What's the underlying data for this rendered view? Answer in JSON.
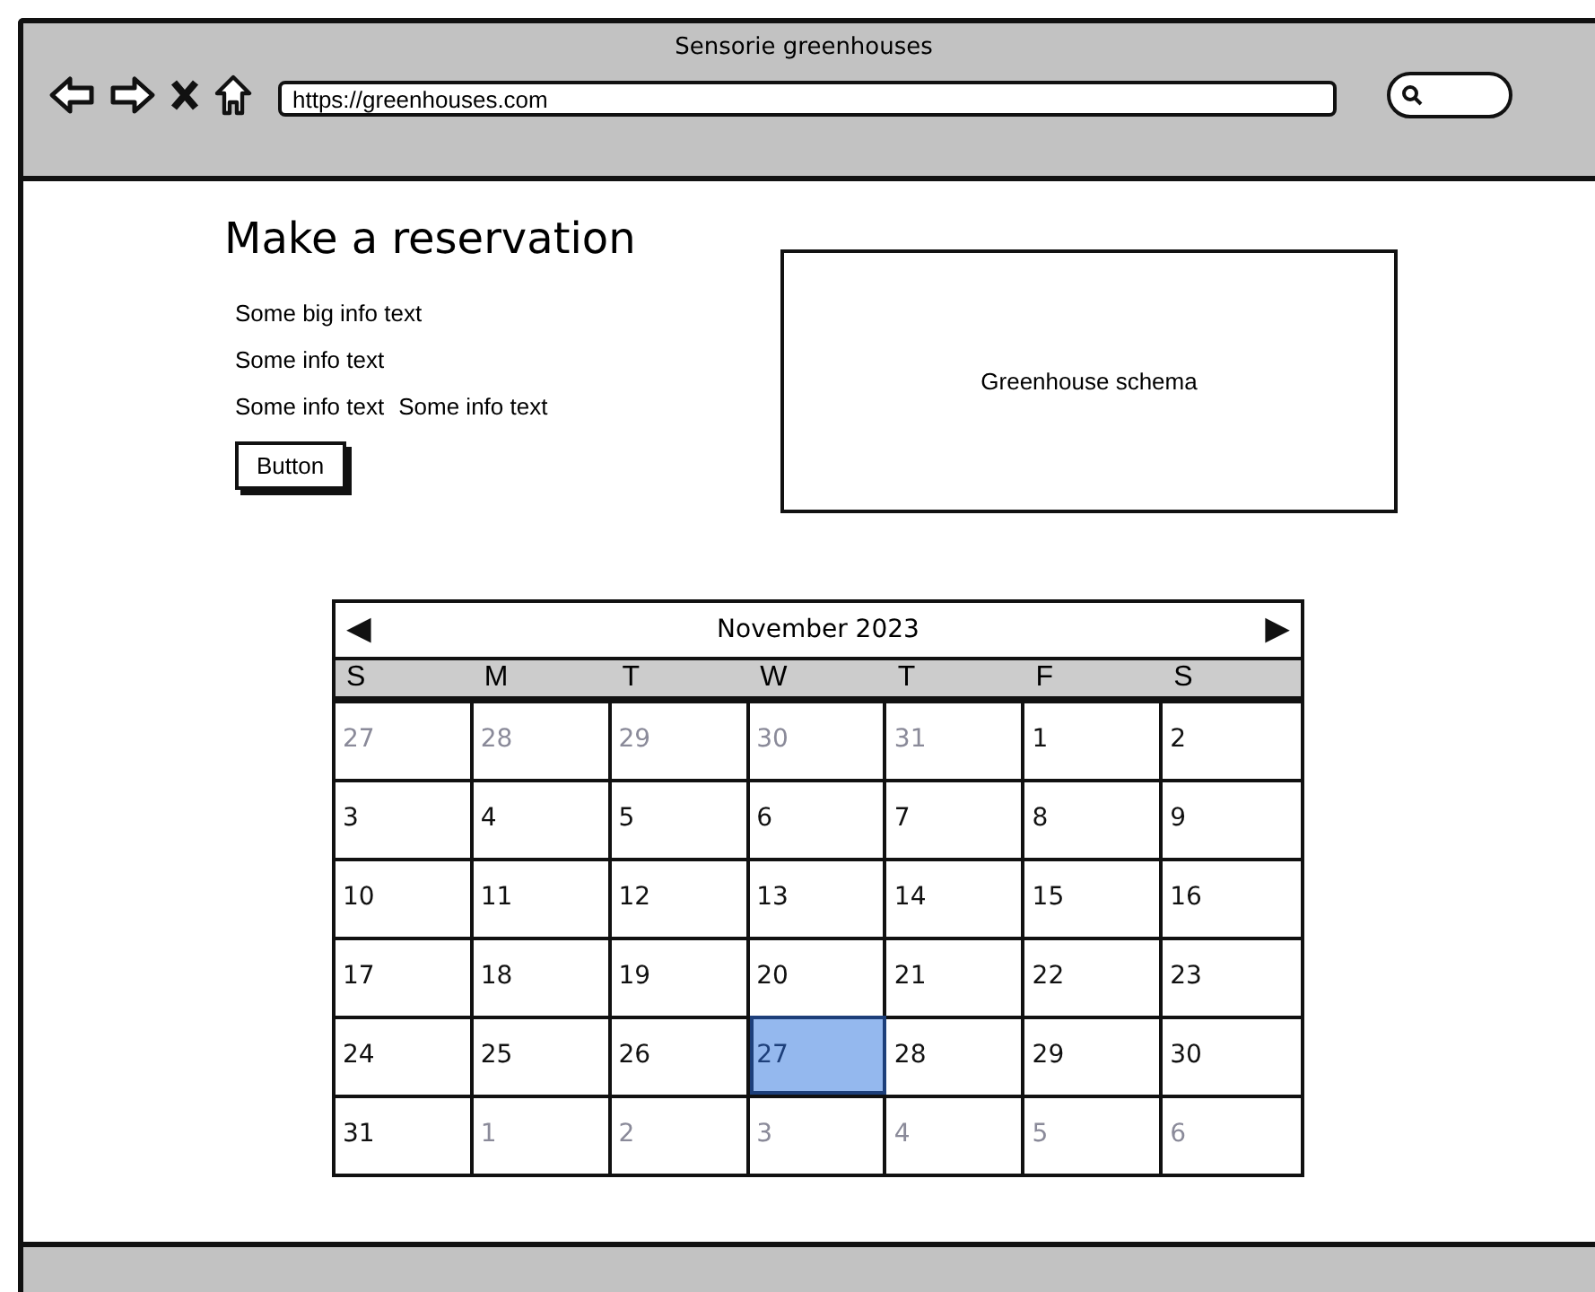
{
  "window": {
    "title": "Sensorie greenhouses"
  },
  "browser": {
    "url": "https://greenhouses.com"
  },
  "page": {
    "heading": "Make a reservation",
    "info_big": "Some big info text",
    "info_lines": [
      [
        "Some info text"
      ],
      [
        "Some info text",
        "Some info text"
      ]
    ],
    "button": "Button",
    "schema": "Greenhouse schema"
  },
  "calendar": {
    "month": "November 2023",
    "prev": "◀",
    "next": "▶",
    "weekdays": [
      "S",
      "M",
      "T",
      "W",
      "T",
      "F",
      "S"
    ],
    "weeks": [
      [
        {
          "day": "27",
          "in_month": false,
          "selected": false
        },
        {
          "day": "28",
          "in_month": false,
          "selected": false
        },
        {
          "day": "29",
          "in_month": false,
          "selected": false
        },
        {
          "day": "30",
          "in_month": false,
          "selected": false
        },
        {
          "day": "31",
          "in_month": false,
          "selected": false
        },
        {
          "day": "1",
          "in_month": true,
          "selected": false
        },
        {
          "day": "2",
          "in_month": true,
          "selected": false
        }
      ],
      [
        {
          "day": "3",
          "in_month": true,
          "selected": false
        },
        {
          "day": "4",
          "in_month": true,
          "selected": false
        },
        {
          "day": "5",
          "in_month": true,
          "selected": false
        },
        {
          "day": "6",
          "in_month": true,
          "selected": false
        },
        {
          "day": "7",
          "in_month": true,
          "selected": false
        },
        {
          "day": "8",
          "in_month": true,
          "selected": false
        },
        {
          "day": "9",
          "in_month": true,
          "selected": false
        }
      ],
      [
        {
          "day": "10",
          "in_month": true,
          "selected": false
        },
        {
          "day": "11",
          "in_month": true,
          "selected": false
        },
        {
          "day": "12",
          "in_month": true,
          "selected": false
        },
        {
          "day": "13",
          "in_month": true,
          "selected": false
        },
        {
          "day": "14",
          "in_month": true,
          "selected": false
        },
        {
          "day": "15",
          "in_month": true,
          "selected": false
        },
        {
          "day": "16",
          "in_month": true,
          "selected": false
        }
      ],
      [
        {
          "day": "17",
          "in_month": true,
          "selected": false
        },
        {
          "day": "18",
          "in_month": true,
          "selected": false
        },
        {
          "day": "19",
          "in_month": true,
          "selected": false
        },
        {
          "day": "20",
          "in_month": true,
          "selected": false
        },
        {
          "day": "21",
          "in_month": true,
          "selected": false
        },
        {
          "day": "22",
          "in_month": true,
          "selected": false
        },
        {
          "day": "23",
          "in_month": true,
          "selected": false
        }
      ],
      [
        {
          "day": "24",
          "in_month": true,
          "selected": false
        },
        {
          "day": "25",
          "in_month": true,
          "selected": false
        },
        {
          "day": "26",
          "in_month": true,
          "selected": false
        },
        {
          "day": "27",
          "in_month": true,
          "selected": true
        },
        {
          "day": "28",
          "in_month": true,
          "selected": false
        },
        {
          "day": "29",
          "in_month": true,
          "selected": false
        },
        {
          "day": "30",
          "in_month": true,
          "selected": false
        }
      ],
      [
        {
          "day": "31",
          "in_month": true,
          "selected": false
        },
        {
          "day": "1",
          "in_month": false,
          "selected": false
        },
        {
          "day": "2",
          "in_month": false,
          "selected": false
        },
        {
          "day": "3",
          "in_month": false,
          "selected": false
        },
        {
          "day": "4",
          "in_month": false,
          "selected": false
        },
        {
          "day": "5",
          "in_month": false,
          "selected": false
        },
        {
          "day": "6",
          "in_month": false,
          "selected": false
        }
      ]
    ]
  }
}
